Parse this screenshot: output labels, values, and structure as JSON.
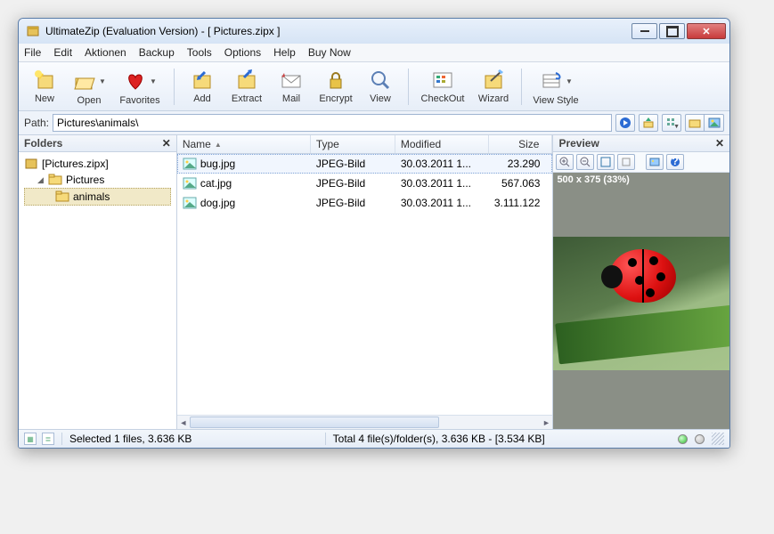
{
  "window": {
    "title": "UltimateZip (Evaluation Version) - [ Pictures.zipx ]"
  },
  "menubar": [
    "File",
    "Edit",
    "Aktionen",
    "Backup",
    "Tools",
    "Options",
    "Help",
    "Buy Now"
  ],
  "toolbar": {
    "new": "New",
    "open": "Open",
    "favorites": "Favorites",
    "add": "Add",
    "extract": "Extract",
    "mail": "Mail",
    "encrypt": "Encrypt",
    "view": "View",
    "checkout": "CheckOut",
    "wizard": "Wizard",
    "viewstyle": "View Style"
  },
  "pathbar": {
    "label": "Path:",
    "value": "Pictures\\animals\\"
  },
  "folders": {
    "title": "Folders",
    "root": "[Pictures.zipx]",
    "node1": "Pictures",
    "node2": "animals"
  },
  "list": {
    "cols": {
      "name": "Name",
      "type": "Type",
      "modified": "Modified",
      "size": "Size"
    },
    "rows": [
      {
        "name": "bug.jpg",
        "type": "JPEG-Bild",
        "modified": "30.03.2011 1...",
        "size": "23.290",
        "selected": true
      },
      {
        "name": "cat.jpg",
        "type": "JPEG-Bild",
        "modified": "30.03.2011 1...",
        "size": "567.063",
        "selected": false
      },
      {
        "name": "dog.jpg",
        "type": "JPEG-Bild",
        "modified": "30.03.2011 1...",
        "size": "3.111.122",
        "selected": false
      }
    ]
  },
  "preview": {
    "title": "Preview",
    "dims": "500 x 375 (33%)"
  },
  "status": {
    "selected": "Selected 1 files, 3.636 KB",
    "total": "Total 4 file(s)/folder(s), 3.636 KB - [3.534 KB]"
  }
}
